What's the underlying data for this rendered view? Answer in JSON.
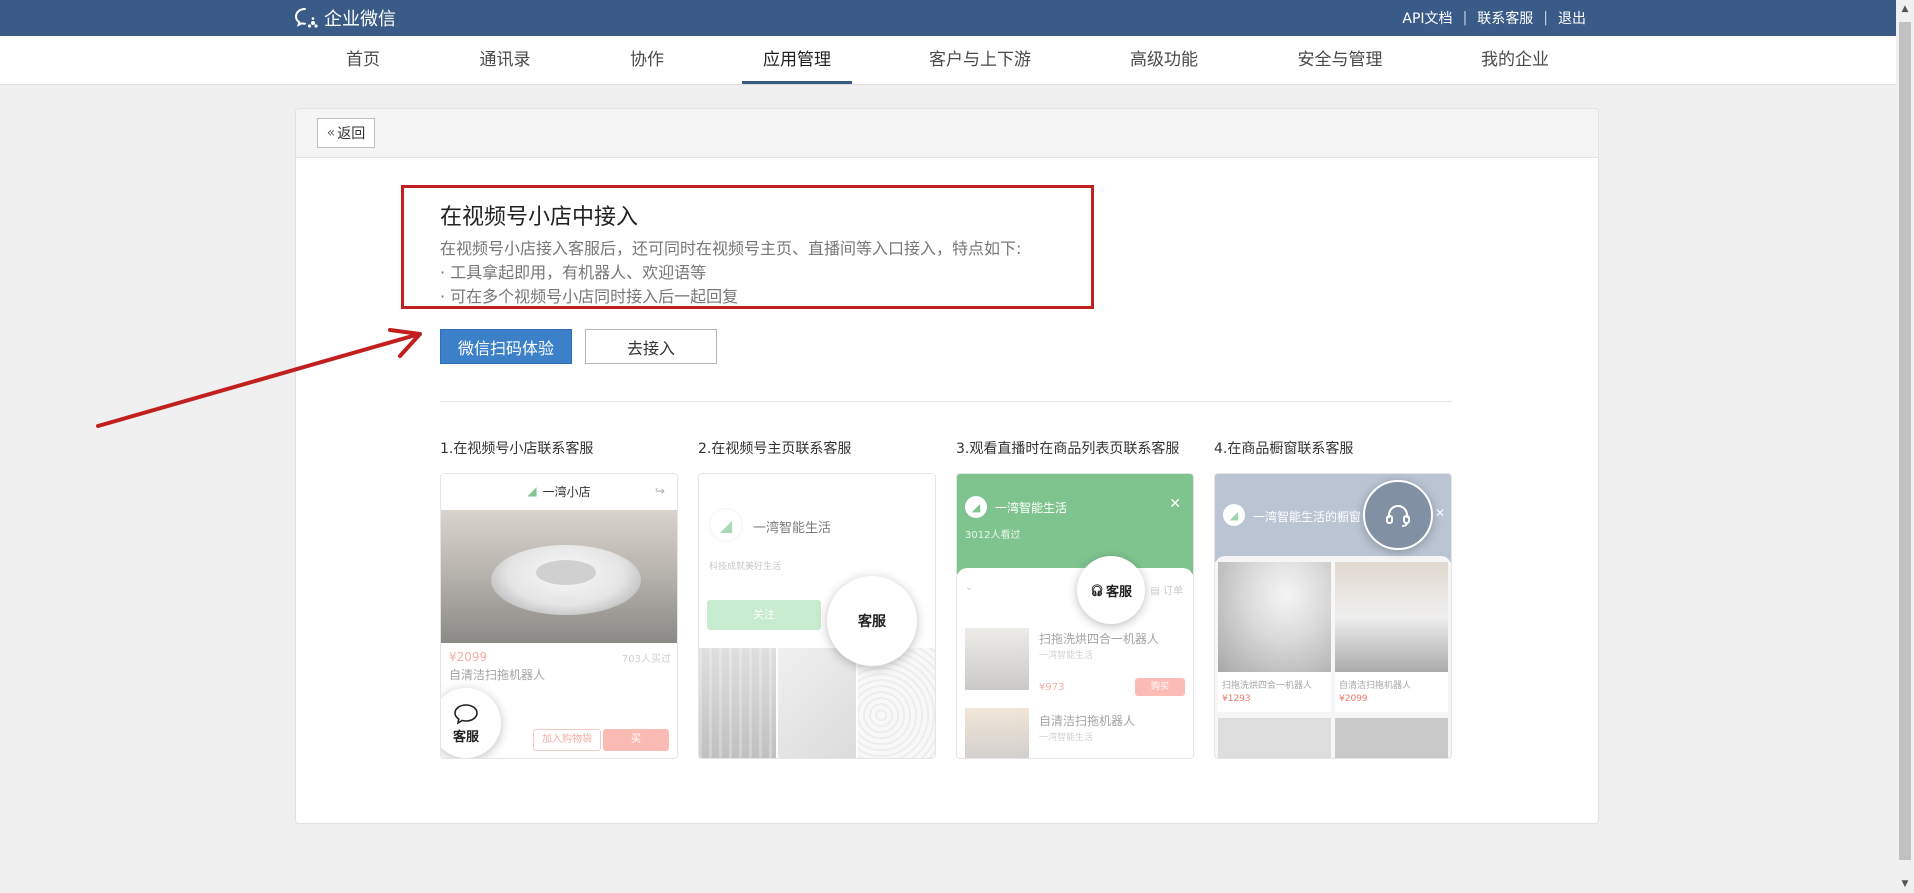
{
  "brand": {
    "name": "企业微信"
  },
  "top_links": [
    "API文档",
    "联系客服",
    "退出"
  ],
  "nav": {
    "items": [
      "首页",
      "通讯录",
      "协作",
      "应用管理",
      "客户与上下游",
      "高级功能",
      "安全与管理",
      "我的企业"
    ],
    "active": "应用管理"
  },
  "back": {
    "label": "返回"
  },
  "section": {
    "title": "在视频号小店中接入",
    "description": "在视频号小店接入客服后，还可同时在视频号主页、直播间等入口接入，特点如下:",
    "bullets": [
      "· 工具拿起即用，有机器人、欢迎语等",
      "· 可在多个视频号小店同时接入后一起回复"
    ]
  },
  "actions": {
    "primary": "微信扫码体验",
    "secondary": "去接入"
  },
  "features": [
    {
      "label": "1.在视频号小店联系客服",
      "shop_name": "一湾小店",
      "price": "¥2099",
      "sold": "703人买过",
      "product": "自清洁扫拖机器人",
      "cart_btn": "加入购物袋",
      "buy_btn": "买",
      "service": "客服"
    },
    {
      "label": "2.在视频号主页联系客服",
      "account": "一湾智能生活",
      "tagline": "科技成就美好生活",
      "follow_btn": "关注",
      "service": "客服"
    },
    {
      "label": "3.观看直播时在商品列表页联系客服",
      "account": "一湾智能生活",
      "viewers": "3012人看过",
      "service": "客服",
      "orders": "订单",
      "products": [
        {
          "name": "扫拖洗烘四合一机器人",
          "shop": "一湾智能生活",
          "price": "¥973",
          "btn": "购买"
        },
        {
          "name": "自清洁扫拖机器人",
          "shop": "一湾智能生活"
        }
      ]
    },
    {
      "label": "4.在商品橱窗联系客服",
      "account": "一湾智能生活的橱窗",
      "products": [
        {
          "name": "扫拖洗烘四合一机器人",
          "price": "¥1293"
        },
        {
          "name": "自清洁扫拖机器人",
          "price": "¥2099"
        }
      ]
    }
  ],
  "colors": {
    "topbar": "#3a5b87",
    "primary": "#3b80c8",
    "annotation": "#c21f1f",
    "green": "#7fc48f"
  }
}
